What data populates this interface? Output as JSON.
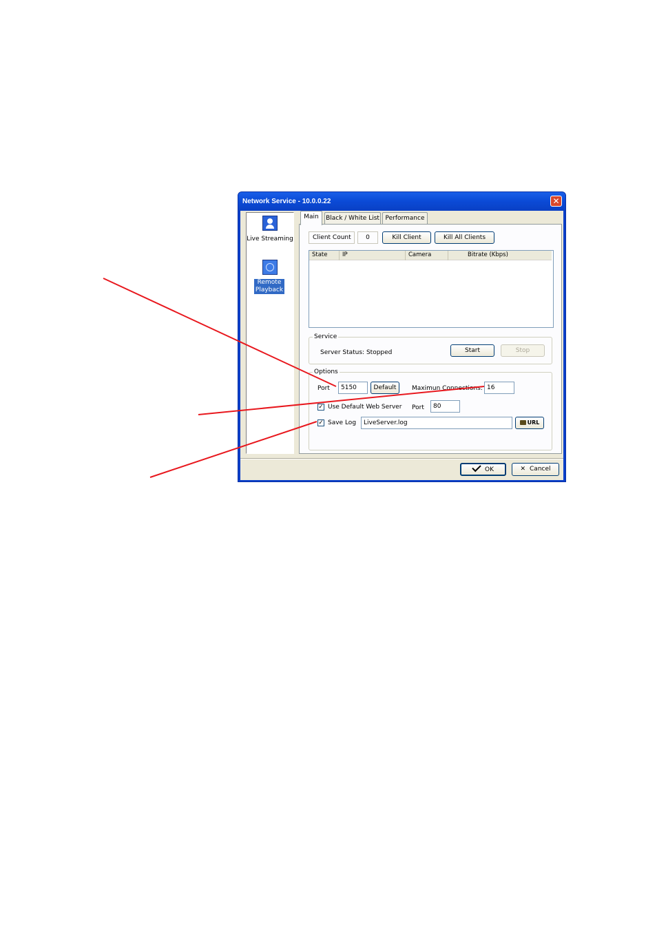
{
  "window": {
    "title": "Network Service - 10.0.0.22",
    "close_glyph": "✕"
  },
  "sidebar": {
    "items": [
      {
        "label": "Live Streaming",
        "icon": "live-streaming-icon"
      },
      {
        "label": "Remote Playback",
        "icon": "remote-playback-icon"
      }
    ]
  },
  "tabs": [
    {
      "label": "Main",
      "active": true
    },
    {
      "label": "Black / White List",
      "active": false
    },
    {
      "label": "Performance",
      "active": false
    }
  ],
  "main": {
    "client_count_label": "Client Count",
    "client_count_value": "0",
    "kill_client": "Kill Client",
    "kill_all_clients": "Kill All Clients",
    "columns": [
      "State",
      "IP",
      "Camera",
      "Bitrate (Kbps)"
    ],
    "rows": [],
    "service": {
      "legend": "Service",
      "status": "Server Status: Stopped",
      "start": "Start",
      "stop": "Stop"
    },
    "options": {
      "legend": "Options",
      "port_label": "Port",
      "port_value": "5150",
      "default_button": "Default",
      "max_conn_label": "Maximun Connections:",
      "max_conn_value": "16",
      "use_default_web_server": "Use Default Web Server",
      "use_default_web_server_checked": true,
      "web_port_label": "Port",
      "web_port_value": "80",
      "save_log": "Save Log",
      "save_log_checked": true,
      "log_file": "LiveServer.log",
      "url_button": "URL"
    }
  },
  "footer": {
    "ok": "OK",
    "cancel": "Cancel"
  },
  "colors": {
    "annotation_line": "#e8171d",
    "titlebar": "#0b4ad6",
    "dialog_bg": "#ece9d8"
  }
}
